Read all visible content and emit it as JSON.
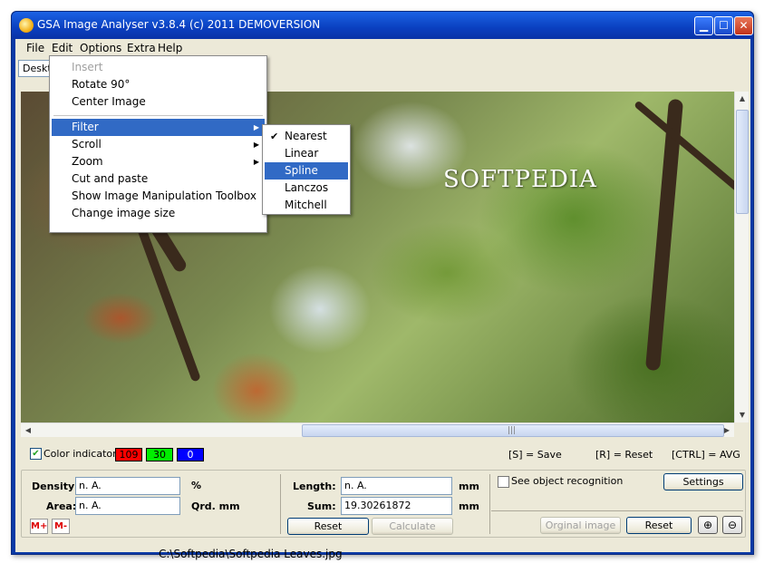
{
  "window": {
    "title": "GSA Image Analyser v3.8.4  (c) 2011   DEMOVERSION"
  },
  "menubar": {
    "file": "File",
    "edit": "Edit",
    "options": "Options",
    "extra": "Extra",
    "help": "Help"
  },
  "tab": {
    "label": "Desktop"
  },
  "image": {
    "watermark": "SOFTPEDIA"
  },
  "colors": {
    "red_value": "109",
    "green_value": "30",
    "blue_value": "0",
    "red": "#ff0000",
    "green": "#00ee00",
    "blue": "#0000ff"
  },
  "color_indicator": {
    "label": "Color indicator",
    "checked": true
  },
  "hints": {
    "save": "[S] = Save",
    "reset": "[R] = Reset",
    "avg": "[CTRL] = AVG"
  },
  "measure": {
    "density_label": "Density:",
    "density_value": "n. A.",
    "density_unit": "%",
    "area_label": "Area:",
    "area_value": "n. A.",
    "area_unit": "Qrd. mm",
    "length_label": "Length:",
    "length_value": "n. A.",
    "length_unit": "mm",
    "sum_label": "Sum:",
    "sum_value": "19.30261872",
    "sum_unit": "mm",
    "reset_label": "Reset",
    "calculate_label": "Calculate",
    "m_plus": "M+",
    "m_minus": "M-"
  },
  "recognition": {
    "label": "See object recognition",
    "settings_label": "Settings",
    "original_label": "Orginal image",
    "reset_label": "Reset"
  },
  "status": {
    "path": "C:\\Softpedia\\Softpedia Leaves.jpg"
  },
  "edit_menu": {
    "items": [
      "Insert",
      "Rotate 90°",
      "Center Image",
      "Filter",
      "Scroll",
      "Zoom",
      "Cut and paste",
      "Show Image Manipulation Toolbox",
      "Change image size"
    ]
  },
  "filter_menu": {
    "items": [
      "Nearest",
      "Linear",
      "Spline",
      "Lanczos",
      "Mitchell"
    ],
    "checked": "Nearest",
    "highlighted": "Spline"
  }
}
